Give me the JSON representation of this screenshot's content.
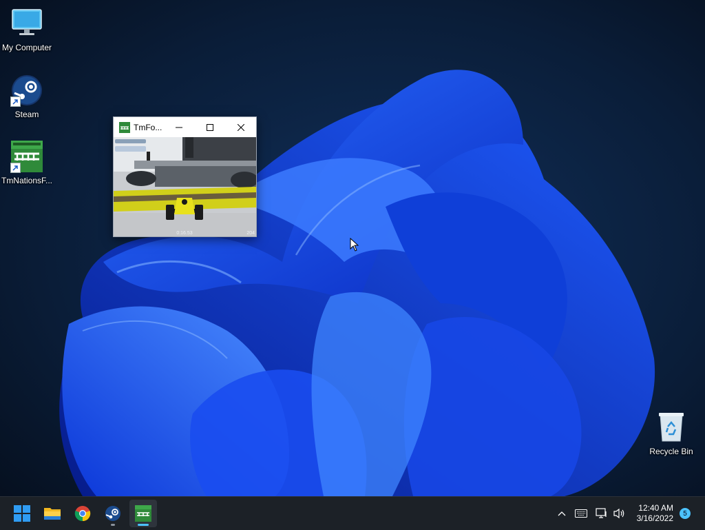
{
  "desktop": {
    "icons": [
      {
        "label": "My Computer",
        "icon": "monitor-icon"
      },
      {
        "label": "Steam",
        "icon": "steam-icon"
      },
      {
        "label": "TmNationsF...",
        "icon": "tmnations-icon"
      },
      {
        "label": "Recycle Bin",
        "icon": "recycle-bin-icon"
      }
    ]
  },
  "game_window": {
    "title": "TmFo...",
    "hud": {
      "timer": "0:16.53",
      "speed": "204"
    }
  },
  "taskbar": {
    "apps": [
      {
        "name": "Start",
        "icon": "windows-start-icon"
      },
      {
        "name": "File Explorer",
        "icon": "folder-icon"
      },
      {
        "name": "Google Chrome",
        "icon": "chrome-icon"
      },
      {
        "name": "Steam",
        "icon": "steam-icon"
      },
      {
        "name": "TmForever",
        "icon": "tmnations-icon",
        "active": true
      }
    ],
    "tray": {
      "time": "12:40 AM",
      "date": "3/16/2022",
      "notifications": "5"
    }
  },
  "colors": {
    "taskbar_bg": "#1c2127",
    "accent": "#4cc2ff"
  }
}
